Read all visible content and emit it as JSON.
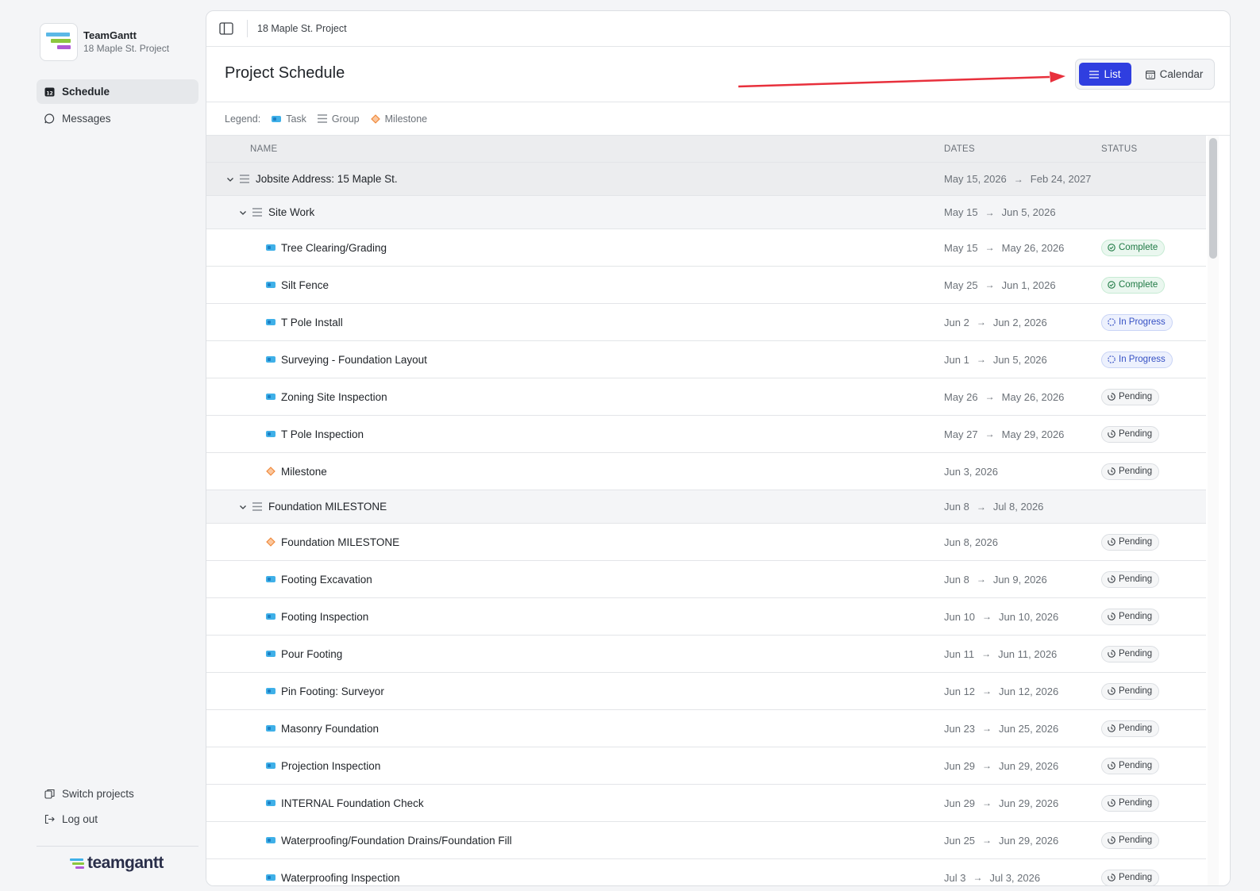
{
  "app": {
    "name": "TeamGantt",
    "project": "18 Maple St. Project",
    "wordmark": "teamgantt"
  },
  "sidebar": {
    "items": [
      {
        "label": "Schedule",
        "icon": "calendar-icon",
        "active": true
      },
      {
        "label": "Messages",
        "icon": "chat-bubble-icon",
        "active": false
      }
    ],
    "footer": [
      {
        "label": "Switch projects",
        "icon": "switch-icon"
      },
      {
        "label": "Log out",
        "icon": "logout-icon"
      }
    ]
  },
  "topbar": {
    "breadcrumb": "18 Maple St. Project"
  },
  "header": {
    "title": "Project Schedule",
    "view_list": "List",
    "view_calendar": "Calendar",
    "active_view": "List"
  },
  "legend": {
    "label": "Legend:",
    "task": "Task",
    "group": "Group",
    "milestone": "Milestone"
  },
  "table": {
    "columns": {
      "name": "NAME",
      "dates": "DATES",
      "status": "STATUS"
    },
    "rows": [
      {
        "kind": "group",
        "level": 0,
        "name": "Jobsite Address: 15 Maple St.",
        "start": "May 15, 2026",
        "end": "Feb 24, 2027",
        "status": ""
      },
      {
        "kind": "group",
        "level": 1,
        "name": "Site Work",
        "start": "May 15",
        "end": "Jun 5, 2026",
        "status": ""
      },
      {
        "kind": "task",
        "name": "Tree Clearing/Grading",
        "start": "May 15",
        "end": "May 26, 2026",
        "status": "Complete"
      },
      {
        "kind": "task",
        "name": "Silt Fence",
        "start": "May 25",
        "end": "Jun 1, 2026",
        "status": "Complete"
      },
      {
        "kind": "task",
        "name": "T Pole Install",
        "start": "Jun 2",
        "end": "Jun 2, 2026",
        "status": "In Progress"
      },
      {
        "kind": "task",
        "name": "Surveying - Foundation Layout",
        "start": "Jun 1",
        "end": "Jun 5, 2026",
        "status": "In Progress"
      },
      {
        "kind": "task",
        "name": "Zoning Site Inspection",
        "start": "May 26",
        "end": "May 26, 2026",
        "status": "Pending"
      },
      {
        "kind": "task",
        "name": "T Pole Inspection",
        "start": "May 27",
        "end": "May 29, 2026",
        "status": "Pending"
      },
      {
        "kind": "milestone",
        "name": "Milestone",
        "start": "Jun 3, 2026",
        "end": "",
        "status": "Pending"
      },
      {
        "kind": "group",
        "level": 1,
        "name": "Foundation MILESTONE",
        "start": "Jun 8",
        "end": "Jul 8, 2026",
        "status": ""
      },
      {
        "kind": "milestone",
        "name": "Foundation MILESTONE",
        "start": "Jun 8, 2026",
        "end": "",
        "status": "Pending"
      },
      {
        "kind": "task",
        "name": "Footing Excavation",
        "start": "Jun 8",
        "end": "Jun 9, 2026",
        "status": "Pending"
      },
      {
        "kind": "task",
        "name": "Footing Inspection",
        "start": "Jun 10",
        "end": "Jun 10, 2026",
        "status": "Pending"
      },
      {
        "kind": "task",
        "name": "Pour Footing",
        "start": "Jun 11",
        "end": "Jun 11, 2026",
        "status": "Pending"
      },
      {
        "kind": "task",
        "name": "Pin Footing: Surveyor",
        "start": "Jun 12",
        "end": "Jun 12, 2026",
        "status": "Pending"
      },
      {
        "kind": "task",
        "name": "Masonry Foundation",
        "start": "Jun 23",
        "end": "Jun 25, 2026",
        "status": "Pending"
      },
      {
        "kind": "task",
        "name": "Projection Inspection",
        "start": "Jun 29",
        "end": "Jun 29, 2026",
        "status": "Pending"
      },
      {
        "kind": "task",
        "name": "INTERNAL Foundation Check",
        "start": "Jun 29",
        "end": "Jun 29, 2026",
        "status": "Pending"
      },
      {
        "kind": "task",
        "name": "Waterproofing/Foundation Drains/Foundation Fill",
        "start": "Jun 25",
        "end": "Jun 29, 2026",
        "status": "Pending"
      },
      {
        "kind": "task",
        "name": "Waterproofing Inspection",
        "start": "Jul 3",
        "end": "Jul 3, 2026",
        "status": "Pending"
      }
    ]
  },
  "colors": {
    "accent": "#2f3ee0",
    "task": "#3fb0e8",
    "milestone": "#f08a3c",
    "annotation_arrow": "#e8303c"
  }
}
